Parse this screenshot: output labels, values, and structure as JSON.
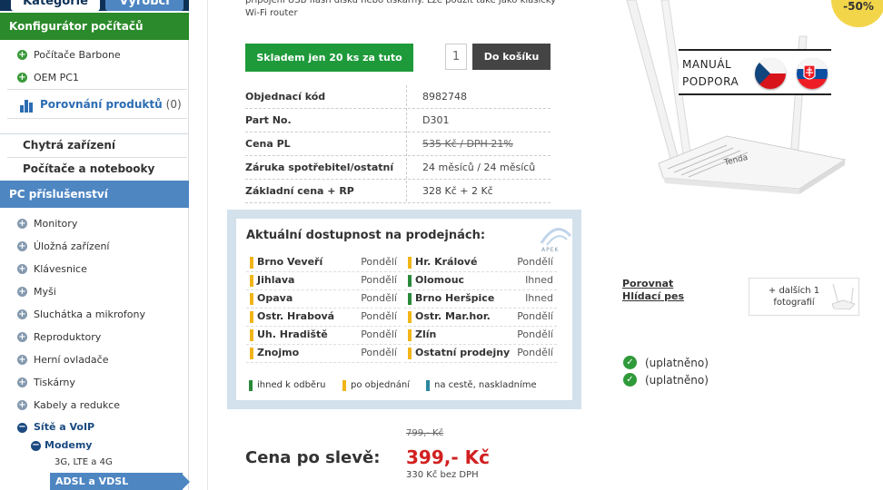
{
  "sidebar": {
    "tabs": {
      "categories": "Kategorie",
      "manufacturers": "Výrobci"
    },
    "configurator": {
      "title": "Konfigurátor počítačů",
      "items": [
        "Počítače Barbone",
        "OEM PC1"
      ]
    },
    "compare": {
      "label": "Porovnání produktů",
      "count": "(0)"
    },
    "plain_items": [
      "Chytrá zařízení",
      "Počítače a notebooky"
    ],
    "pc_accessories": {
      "title": "PC příslušenství",
      "items": [
        "Monitory",
        "Úložná zařízení",
        "Klávesnice",
        "Myši",
        "Sluchátka a mikrofony",
        "Reproduktory",
        "Herní ovladače",
        "Tiskárny",
        "Kabely a redukce"
      ]
    },
    "net_voip": "Sítě a VoIP",
    "modems": "Modemy",
    "lte": "3G, LTE a 4G",
    "adsl": "ADSL a VDSL"
  },
  "product": {
    "intro": "připojení USB flash disků nebo tiskárny. Lze použít také jako klasický Wi-Fi router",
    "stock_button": "Skladem jen 20 ks za tuto cenu",
    "quantity": "1",
    "cart_button": "Do košíku",
    "specs": [
      {
        "key": "Objednací kód",
        "value": "8982748",
        "strike": false
      },
      {
        "key": "Part No.",
        "value": "D301",
        "strike": false
      },
      {
        "key": "Cena PL",
        "value": "535 Kč / DPH 21%",
        "strike": true
      },
      {
        "key": "Záruka spotřebitel/ostatní",
        "value": "24 měsíců / 24 měsíců",
        "strike": false
      },
      {
        "key": "Základní cena + RP",
        "value": "328 Kč + 2 Kč",
        "strike": false
      }
    ]
  },
  "availability": {
    "title": "Aktuální dostupnost na prodejnách:",
    "logo_text": "APEK",
    "left": [
      {
        "name": "Brno Veveří",
        "status": "Pondělí",
        "color": "#f2b519"
      },
      {
        "name": "Jihlava",
        "status": "Pondělí",
        "color": "#f2b519"
      },
      {
        "name": "Opava",
        "status": "Pondělí",
        "color": "#f2b519"
      },
      {
        "name": "Ostr. Hrabová",
        "status": "Pondělí",
        "color": "#f2b519"
      },
      {
        "name": "Uh. Hradiště",
        "status": "Pondělí",
        "color": "#f2b519"
      },
      {
        "name": "Znojmo",
        "status": "Pondělí",
        "color": "#f2b519"
      }
    ],
    "right": [
      {
        "name": "Hr. Králové",
        "status": "Pondělí",
        "color": "#f2b519"
      },
      {
        "name": "Olomouc",
        "status": "Ihned",
        "color": "#2a8a3a"
      },
      {
        "name": "Brno Heršpice",
        "status": "Ihned",
        "color": "#2a8a3a"
      },
      {
        "name": "Ostr. Mar.hor.",
        "status": "Pondělí",
        "color": "#f2b519"
      },
      {
        "name": "Zlín",
        "status": "Pondělí",
        "color": "#f2b519"
      },
      {
        "name": "Ostatní prodejny",
        "status": "Pondělí",
        "color": "#f2b519"
      }
    ],
    "legend": [
      {
        "label": "ihned k odběru",
        "color": "#2a8a3a"
      },
      {
        "label": "po objednání",
        "color": "#f2b519"
      },
      {
        "label": "na cestě, naskladníme",
        "color": "#2b86a0"
      }
    ]
  },
  "pricing": {
    "old_price": "799,- Kč",
    "sale_label": "Cena po slevě:",
    "sale_price": "399,- Kč",
    "price_no_vat": "330 Kč bez DPH"
  },
  "gallery": {
    "discount": "-50%",
    "manual_line1": "MANUÁL",
    "manual_line2": "PODPORA",
    "brand": "Tenda",
    "compare_link": "Porovnat",
    "watch_link": "Hlídací pes",
    "more_photos": "+ dalších 1 fotografií"
  },
  "checks": [
    "(uplatněno)",
    "(uplatněno)"
  ],
  "colors": {
    "green": "#1e9a3a",
    "blue": "#4e86c2",
    "navy": "#0e3257",
    "red": "#d22020",
    "yellow": "#f3d54a"
  }
}
